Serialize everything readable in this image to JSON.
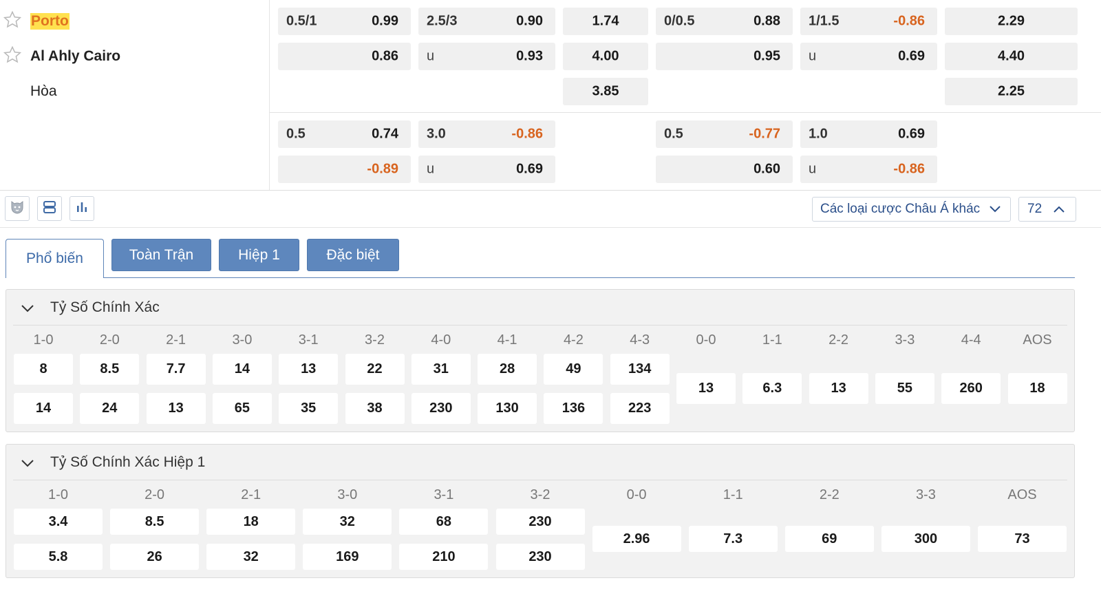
{
  "teams": {
    "home": "Porto",
    "away": "Al Ahly Cairo",
    "draw": "Hòa"
  },
  "odds": {
    "main": {
      "h1": {
        "label": "0.5/1",
        "value": "0.99"
      },
      "h2": {
        "value": "0.86"
      },
      "ou1": {
        "label": "2.5/3",
        "value": "0.90"
      },
      "ou2": {
        "label": "u",
        "value": "0.93"
      },
      "x1": "1.74",
      "x2": "4.00",
      "x3": "3.85",
      "fh1": {
        "label": "0/0.5",
        "value": "0.88"
      },
      "fh2": {
        "value": "0.95"
      },
      "fou1": {
        "label": "1/1.5",
        "value": "-0.86"
      },
      "fou2": {
        "label": "u",
        "value": "0.69"
      },
      "fx1": "2.29",
      "fx2": "4.40",
      "fx3": "2.25"
    },
    "alt": {
      "h1": {
        "label": "0.5",
        "value": "0.74"
      },
      "h2": {
        "value": "-0.89"
      },
      "ou1": {
        "label": "3.0",
        "value": "-0.86"
      },
      "ou2": {
        "label": "u",
        "value": "0.69"
      },
      "fh1": {
        "label": "0.5",
        "value": "-0.77"
      },
      "fh2": {
        "value": "0.60"
      },
      "fou1": {
        "label": "1.0",
        "value": "0.69"
      },
      "fou2": {
        "label": "u",
        "value": "-0.86"
      }
    }
  },
  "toolbar": {
    "dropdown_label": "Các loại cược Châu Á khác",
    "count": "72"
  },
  "tabs": [
    "Phổ biến",
    "Toàn Trận",
    "Hiệp 1",
    "Đặc biệt"
  ],
  "correct_score": {
    "title": "Tỷ Số Chính Xác",
    "home_headers": [
      "1-0",
      "2-0",
      "2-1",
      "3-0",
      "3-1",
      "3-2",
      "4-0",
      "4-1",
      "4-2",
      "4-3"
    ],
    "home_win": [
      "8",
      "8.5",
      "7.7",
      "14",
      "13",
      "22",
      "31",
      "28",
      "49",
      "134"
    ],
    "away_win": [
      "14",
      "24",
      "13",
      "65",
      "35",
      "38",
      "230",
      "130",
      "136",
      "223"
    ],
    "draw_headers": [
      "0-0",
      "1-1",
      "2-2",
      "3-3",
      "4-4",
      "AOS"
    ],
    "draw": [
      "13",
      "6.3",
      "13",
      "55",
      "260",
      "18"
    ]
  },
  "correct_score_h1": {
    "title": "Tỷ Số Chính Xác Hiệp 1",
    "home_headers": [
      "1-0",
      "2-0",
      "2-1",
      "3-0",
      "3-1",
      "3-2"
    ],
    "home_win": [
      "3.4",
      "8.5",
      "18",
      "32",
      "68",
      "230"
    ],
    "away_win": [
      "5.8",
      "26",
      "32",
      "169",
      "210",
      "230"
    ],
    "draw_headers": [
      "0-0",
      "1-1",
      "2-2",
      "3-3",
      "AOS"
    ],
    "draw": [
      "2.96",
      "7.3",
      "69",
      "300",
      "73"
    ]
  },
  "colors": {
    "accent": "#5e87bd",
    "negative": "#d8641f",
    "highlight": "#ffe14f"
  }
}
